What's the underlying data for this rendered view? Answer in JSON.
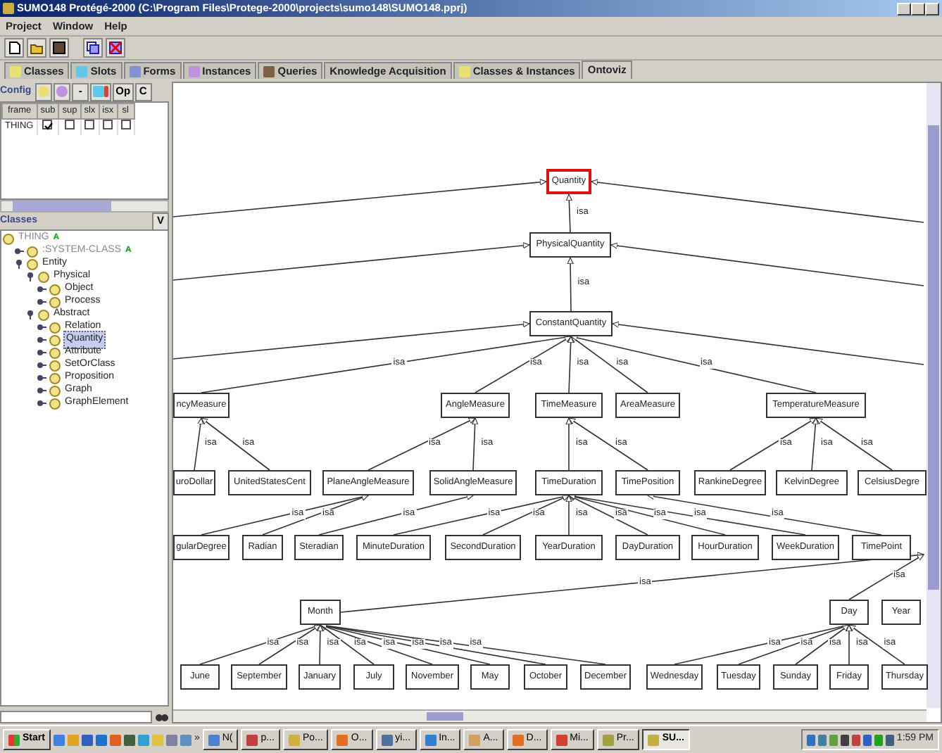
{
  "window": {
    "title": "SUMO148  Protégé-2000   (C:\\Program Files\\Protege-2000\\projects\\sumo148\\SUMO148.pprj)"
  },
  "menu": [
    "Project",
    "Window",
    "Help"
  ],
  "tabs": [
    {
      "label": "Classes",
      "selected": false
    },
    {
      "label": "Slots",
      "selected": false
    },
    {
      "label": "Forms",
      "selected": false
    },
    {
      "label": "Instances",
      "selected": false
    },
    {
      "label": "Queries",
      "selected": false
    },
    {
      "label": "Knowledge Acquisition",
      "selected": false
    },
    {
      "label": "Classes & Instances",
      "selected": false
    },
    {
      "label": "Ontoviz",
      "selected": true
    }
  ],
  "config": {
    "label": "Config",
    "buttons": [
      "-",
      "Op",
      "C"
    ],
    "columns": [
      "frame",
      "sub",
      "sup",
      "slx",
      "isx",
      "sl"
    ],
    "rows": [
      {
        "frame": "THING",
        "checks": [
          true,
          false,
          false,
          false,
          false
        ]
      }
    ]
  },
  "classes": {
    "label": "Classes",
    "button": "V",
    "tree": [
      {
        "label": "THING",
        "badge": "A",
        "muted": true,
        "selected": false,
        "children": [
          {
            "label": ":SYSTEM-CLASS",
            "badge": "A",
            "muted": true,
            "selected": false,
            "expanded": false
          },
          {
            "label": "Entity",
            "selected": false,
            "expanded": true,
            "children": [
              {
                "label": "Physical",
                "selected": false,
                "expanded": true,
                "children": [
                  {
                    "label": "Object",
                    "selected": false,
                    "expanded": false
                  },
                  {
                    "label": "Process",
                    "selected": false,
                    "expanded": false
                  }
                ]
              },
              {
                "label": "Abstract",
                "selected": false,
                "expanded": true,
                "children": [
                  {
                    "label": "Relation",
                    "selected": false,
                    "expanded": false
                  },
                  {
                    "label": "Quantity",
                    "selected": true,
                    "expanded": false
                  },
                  {
                    "label": "Attribute",
                    "selected": false,
                    "expanded": false
                  },
                  {
                    "label": "SetOrClass",
                    "selected": false,
                    "expanded": false
                  },
                  {
                    "label": "Proposition",
                    "selected": false,
                    "expanded": false
                  },
                  {
                    "label": "Graph",
                    "selected": false,
                    "expanded": false
                  },
                  {
                    "label": "GraphElement",
                    "selected": false,
                    "expanded": false
                  }
                ]
              }
            ]
          }
        ]
      }
    ]
  },
  "diagram": {
    "nodes": [
      {
        "label": "Quantity",
        "selected": true
      },
      {
        "label": "PhysicalQuantity",
        "selected": false,
        "edge_label": "isa"
      },
      {
        "label": "ConstantQuantity",
        "selected": false,
        "edge_label": "isa"
      },
      {
        "label": "ncyMeasure",
        "selected": false,
        "edge_label": "isa"
      },
      {
        "label": "AngleMeasure",
        "selected": false,
        "edge_label": "isa"
      },
      {
        "label": "TimeMeasure",
        "selected": false,
        "edge_label": "isa"
      },
      {
        "label": "AreaMeasure",
        "selected": false,
        "edge_label": "isa"
      },
      {
        "label": "TemperatureMeasure",
        "selected": false,
        "edge_label": "isa"
      },
      {
        "label": "uroDollar",
        "selected": false,
        "edge_label": "isa"
      },
      {
        "label": "UnitedStatesCent",
        "selected": false,
        "edge_label": "isa"
      },
      {
        "label": "PlaneAngleMeasure",
        "selected": false,
        "edge_label": "isa"
      },
      {
        "label": "SolidAngleMeasure",
        "selected": false,
        "edge_label": "isa"
      },
      {
        "label": "TimeDuration",
        "selected": false,
        "edge_label": "isa"
      },
      {
        "label": "TimePosition",
        "selected": false,
        "edge_label": "isa"
      },
      {
        "label": "RankineDegree",
        "selected": false,
        "edge_label": "isa"
      },
      {
        "label": "KelvinDegree",
        "selected": false,
        "edge_label": "isa"
      },
      {
        "label": "CelsiusDegre",
        "selected": false,
        "edge_label": "isa"
      },
      {
        "label": "gularDegree",
        "selected": false,
        "edge_label": "isa"
      },
      {
        "label": "Radian",
        "selected": false,
        "edge_label": "isa"
      },
      {
        "label": "Steradian",
        "selected": false,
        "edge_label": "isa"
      },
      {
        "label": "MinuteDuration",
        "selected": false,
        "edge_label": "isa"
      },
      {
        "label": "SecondDuration",
        "selected": false,
        "edge_label": "isa"
      },
      {
        "label": "YearDuration",
        "selected": false,
        "edge_label": "isa"
      },
      {
        "label": "DayDuration",
        "selected": false,
        "edge_label": "isa"
      },
      {
        "label": "HourDuration",
        "selected": false,
        "edge_label": "isa"
      },
      {
        "label": "WeekDuration",
        "selected": false,
        "edge_label": "isa"
      },
      {
        "label": "TimePoint",
        "selected": false,
        "edge_label": "isa"
      },
      {
        "label": "Month",
        "selected": false,
        "edge_label": "isa"
      },
      {
        "label": "Day",
        "selected": false,
        "edge_label": "isa"
      },
      {
        "label": "Year",
        "selected": false
      },
      {
        "label": "June",
        "selected": false,
        "edge_label": "isa"
      },
      {
        "label": "September",
        "selected": false,
        "edge_label": "isa"
      },
      {
        "label": "January",
        "selected": false,
        "edge_label": "isa"
      },
      {
        "label": "July",
        "selected": false,
        "edge_label": "isa"
      },
      {
        "label": "November",
        "selected": false,
        "edge_label": "isa"
      },
      {
        "label": "May",
        "selected": false,
        "edge_label": "isa"
      },
      {
        "label": "October",
        "selected": false,
        "edge_label": "isa"
      },
      {
        "label": "December",
        "selected": false,
        "edge_label": "isa"
      },
      {
        "label": "Wednesday",
        "selected": false,
        "edge_label": "isa"
      },
      {
        "label": "Tuesday",
        "selected": false,
        "edge_label": "isa"
      },
      {
        "label": "Sunday",
        "selected": false,
        "edge_label": "isa"
      },
      {
        "label": "Friday",
        "selected": false,
        "edge_label": "isa"
      },
      {
        "label": "Thursday",
        "selected": false,
        "edge_label": "isa"
      }
    ]
  },
  "taskbar": {
    "start": "Start",
    "more": "»",
    "tasks": [
      {
        "label": "N(",
        "selected": false
      },
      {
        "label": "p...",
        "selected": false
      },
      {
        "label": "Po...",
        "selected": false
      },
      {
        "label": "O...",
        "selected": false
      },
      {
        "label": "yi...",
        "selected": false
      },
      {
        "label": "In...",
        "selected": false
      },
      {
        "label": "A...",
        "selected": false
      },
      {
        "label": "D...",
        "selected": false
      },
      {
        "label": "Mi...",
        "selected": false
      },
      {
        "label": "Pr...",
        "selected": false
      },
      {
        "label": "SU...",
        "selected": true
      }
    ],
    "clock": "1:59 PM"
  }
}
